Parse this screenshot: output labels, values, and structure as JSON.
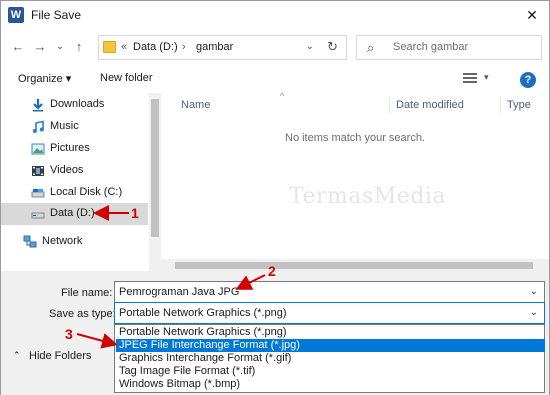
{
  "window": {
    "title": "File Save",
    "app_icon": "W",
    "close_glyph": "✕"
  },
  "nav": {
    "back_glyph": "←",
    "forward_glyph": "→",
    "recent_glyph": "⌄",
    "up_glyph": "↑"
  },
  "address": {
    "overflow": "«",
    "segments": [
      "Data (D:)",
      "gambar"
    ],
    "separator": "›",
    "dropdown_glyph": "⌄",
    "refresh_glyph": "↻"
  },
  "search": {
    "placeholder": "Search gambar",
    "icon_glyph": "⌕"
  },
  "toolbar": {
    "organize_label": "Organize ▾",
    "new_folder_label": "New folder",
    "view_dd_glyph": "▾",
    "help_glyph": "?"
  },
  "sidebar": {
    "items": [
      {
        "label": "Downloads",
        "icon": "download-icon"
      },
      {
        "label": "Music",
        "icon": "music-icon"
      },
      {
        "label": "Pictures",
        "icon": "pictures-icon"
      },
      {
        "label": "Videos",
        "icon": "videos-icon"
      },
      {
        "label": "Local Disk (C:)",
        "icon": "local-disk-icon"
      },
      {
        "label": "Data (D:)",
        "icon": "drive-icon",
        "selected": true
      },
      {
        "label": "Network",
        "icon": "network-icon"
      }
    ]
  },
  "filelist": {
    "columns": [
      "Name",
      "Date modified",
      "Type"
    ],
    "sort_glyph": "^",
    "empty_message": "No items match your search.",
    "watermark": "TermasMedia"
  },
  "form": {
    "file_name_label": "File name:",
    "file_name_value": "Pemrograman Java JPG",
    "save_as_type_label": "Save as type:",
    "save_as_type_value": "Portable Network Graphics (*.png)",
    "dropdown_glyph": "⌄",
    "type_options": [
      "Portable Network Graphics (*.png)",
      "JPEG File Interchange Format (*.jpg)",
      "Graphics Interchange Format (*.gif)",
      "Tag Image File Format (*.tif)",
      "Windows Bitmap (*.bmp)"
    ],
    "selected_option_index": 1,
    "hide_folders_label": "Hide Folders",
    "hide_folders_glyph": "⌃"
  },
  "annotations": {
    "marker_1": "1",
    "marker_2": "2",
    "marker_3": "3",
    "color": "#d00000"
  },
  "colors": {
    "accent": "#0078d7",
    "word_brand": "#2b579a",
    "help": "#1f6dc2",
    "selected_nav": "#d9d9d9"
  }
}
